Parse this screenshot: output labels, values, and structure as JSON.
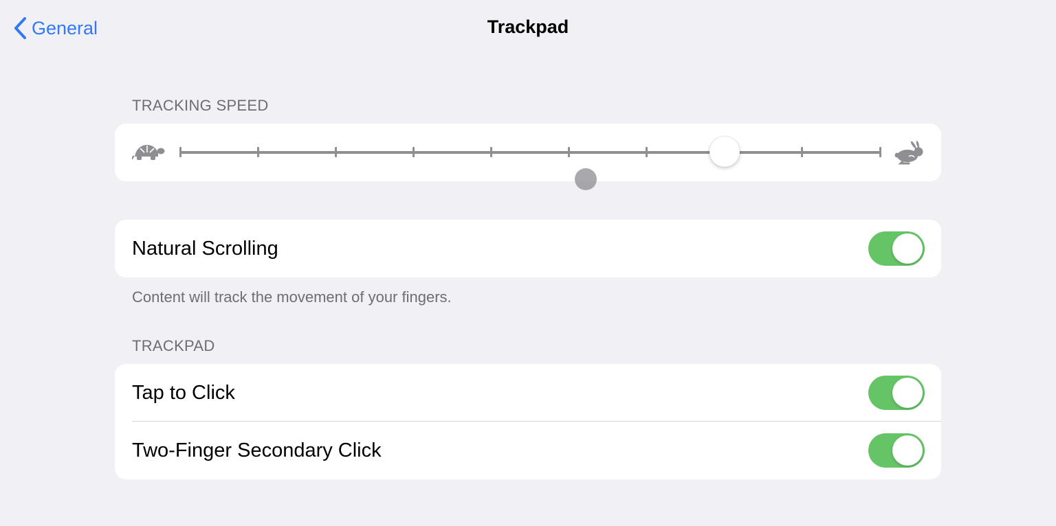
{
  "nav": {
    "back_label": "General",
    "title": "Trackpad"
  },
  "tracking_speed": {
    "header": "TRACKING SPEED",
    "slider_steps": 10,
    "slider_value_index": 7,
    "min_icon": "turtle-icon",
    "max_icon": "rabbit-icon"
  },
  "natural_scrolling": {
    "label": "Natural Scrolling",
    "on": true,
    "footer": "Content will track the movement of your fingers."
  },
  "trackpad_section": {
    "header": "TRACKPAD",
    "items": [
      {
        "label": "Tap to Click",
        "on": true
      },
      {
        "label": "Two-Finger Secondary Click",
        "on": true
      }
    ]
  },
  "colors": {
    "accent": "#3478f6",
    "toggle_on": "#65c466",
    "background": "#f0f0f5"
  }
}
